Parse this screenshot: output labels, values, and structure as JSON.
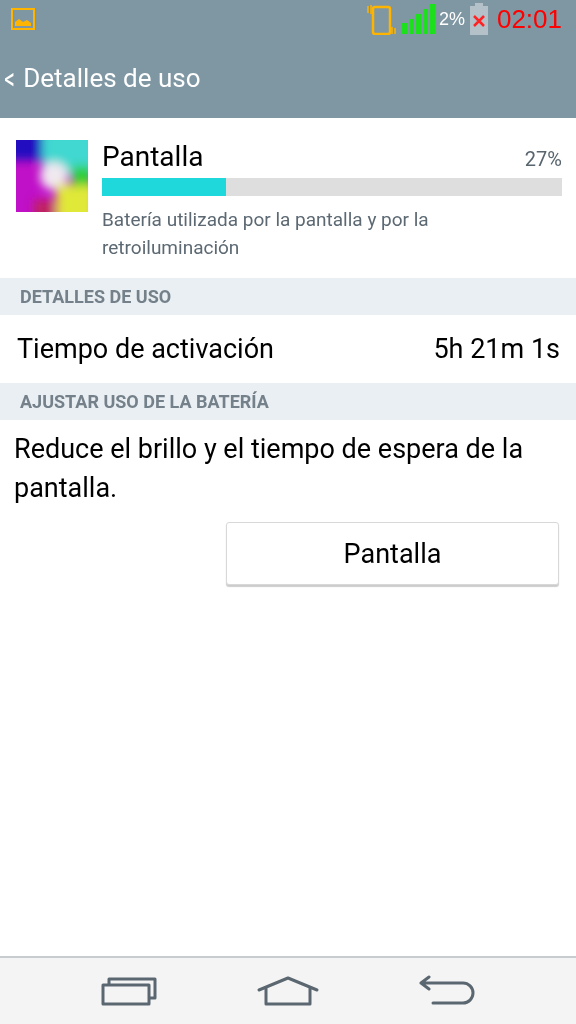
{
  "status_bar": {
    "battery_percent": "2%",
    "time": "02:01"
  },
  "header": {
    "back": "<",
    "title": "Detalles de uso"
  },
  "app": {
    "name": "Pantalla",
    "percent": "27%",
    "level": 0.27,
    "description": "Batería utilizada por la pantalla y por la retroiluminación"
  },
  "sections": [
    {
      "title": "DETALLES DE USO",
      "kind": "row",
      "label": "Tiempo de activación",
      "value": "5h 21m 1s"
    },
    {
      "title": "AJUSTAR USO DE LA BATERÍA",
      "kind": "advice",
      "text": "Reduce el brillo y el tiempo de espera de la pantalla.",
      "button": "Pantalla"
    }
  ]
}
